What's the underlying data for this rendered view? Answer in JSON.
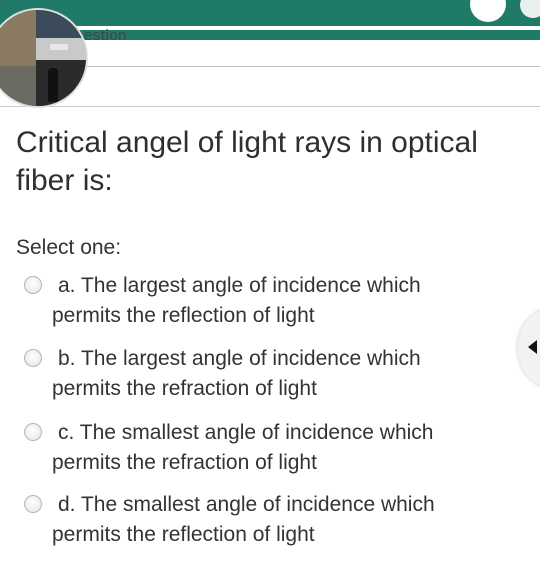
{
  "header": {
    "tab_label": "estion",
    "accent_color": "#1f7a67"
  },
  "question": {
    "text": "Critical angel of light rays in optical fiber is:",
    "prompt": "Select one:",
    "options": [
      {
        "line1": "a. The largest angle of incidence which",
        "line2": "permits the reflection of light",
        "selected": false
      },
      {
        "line1": "b. The largest angle of incidence which",
        "line2": "permits the refraction of light",
        "selected": false
      },
      {
        "line1": "c. The smallest angle of incidence which",
        "line2": "permits the refraction of light",
        "selected": false
      },
      {
        "line1": "d. The smallest angle of incidence which",
        "line2": "permits the reflection of light",
        "selected": false
      }
    ]
  },
  "icons": {
    "side_tab": "chevron-left-icon",
    "avatar": "profile-photo"
  }
}
